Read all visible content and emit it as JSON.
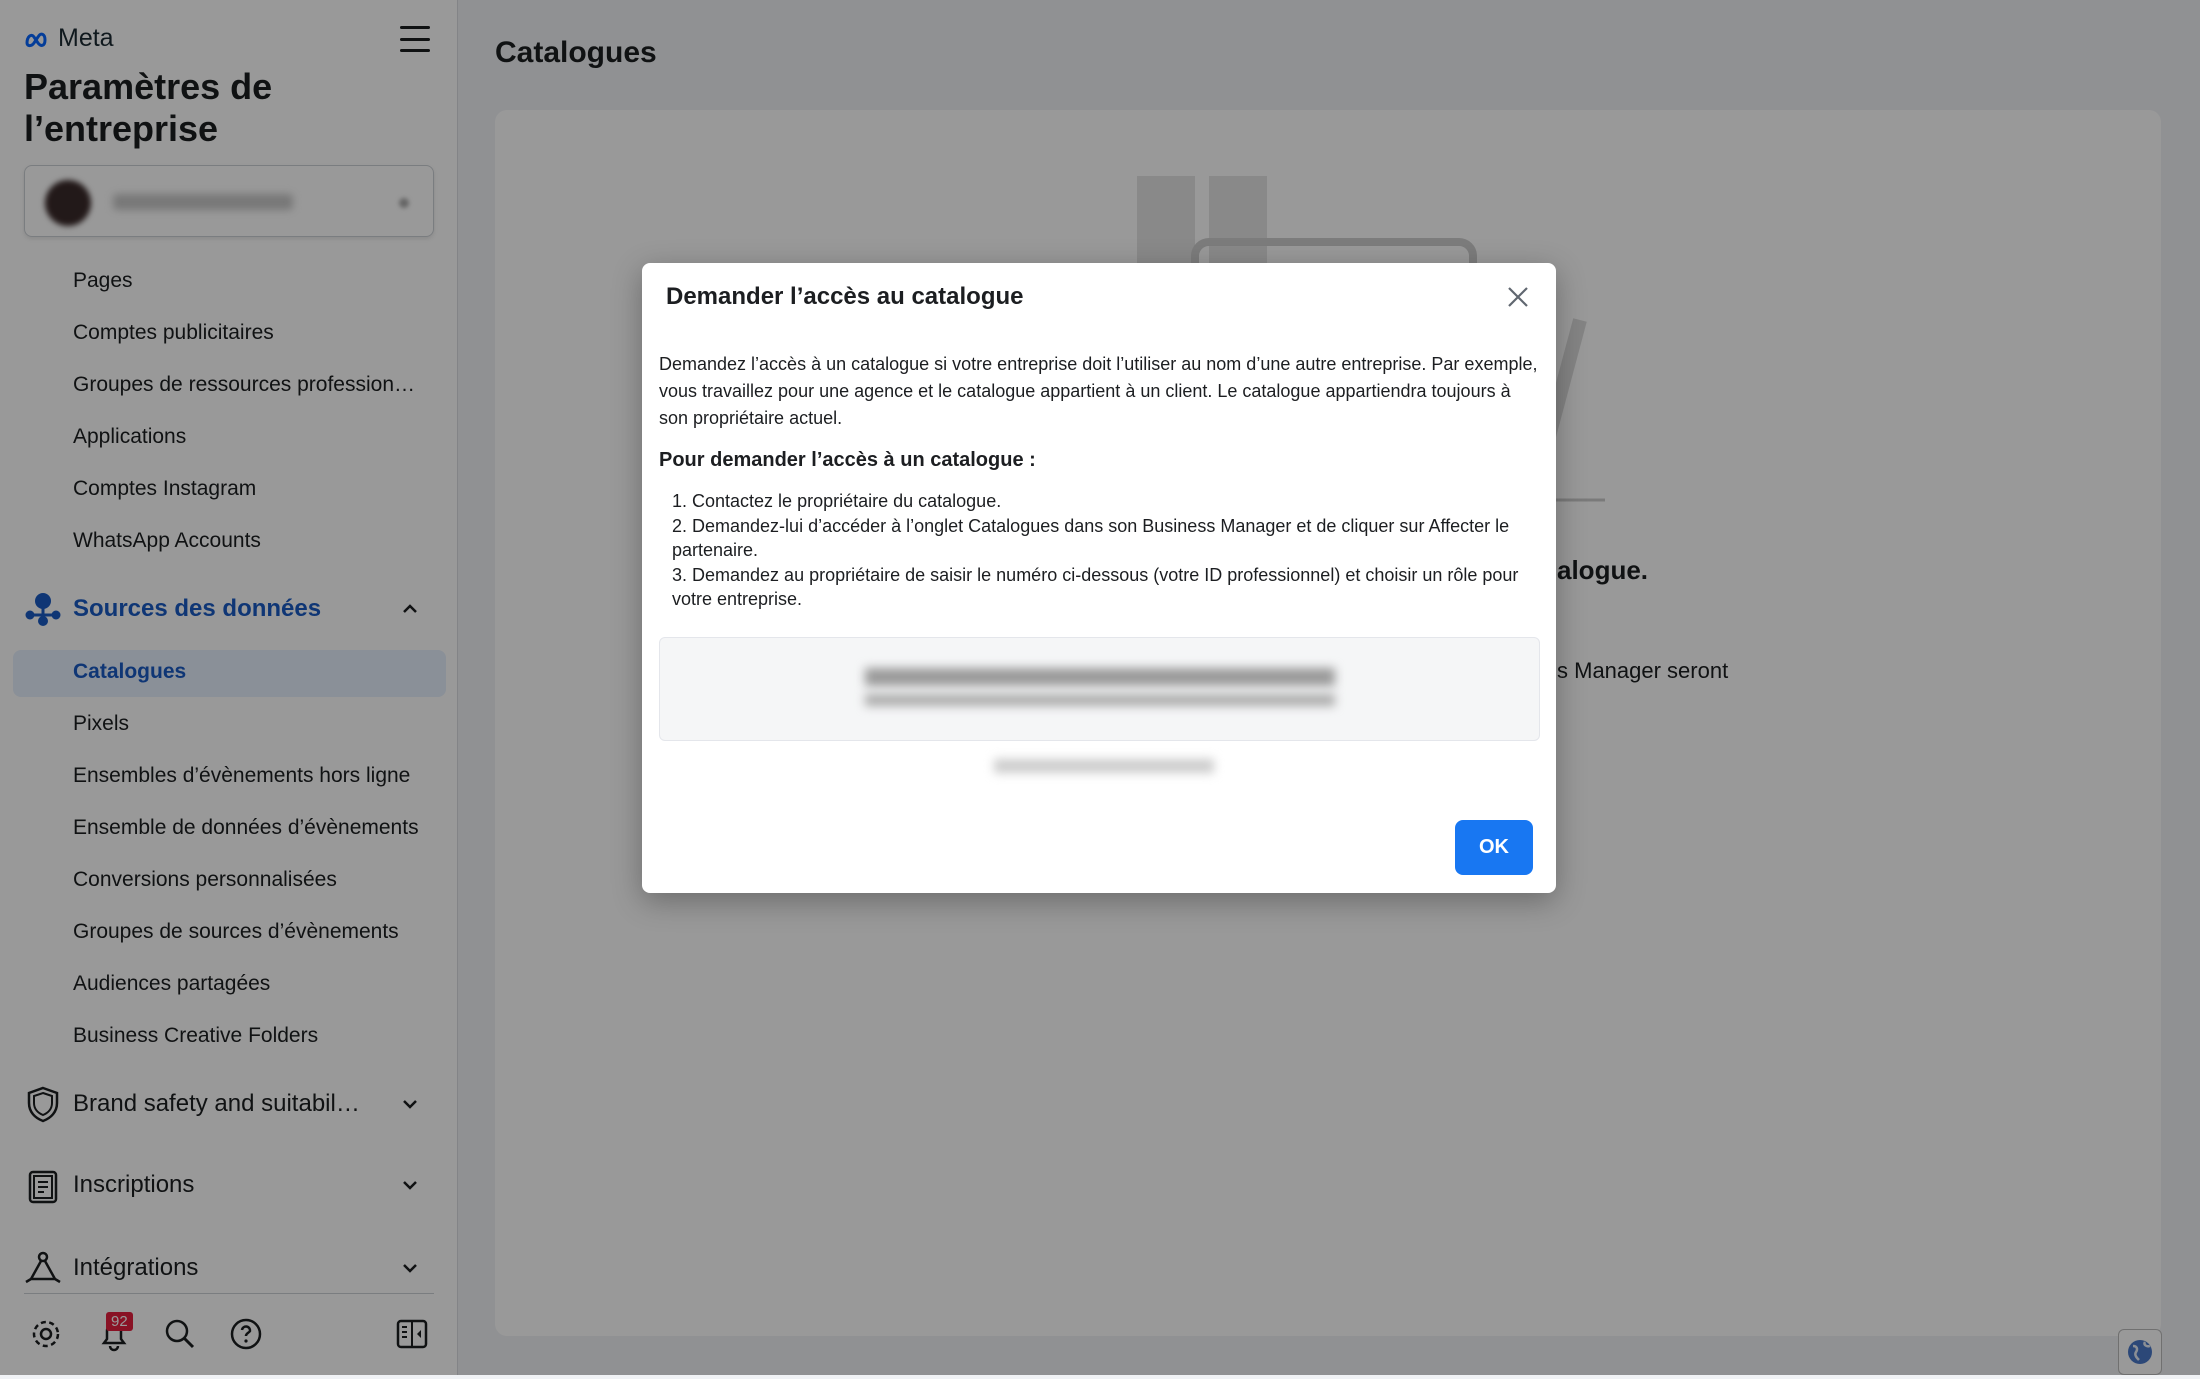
{
  "brand": {
    "logo": "Meta"
  },
  "sidebar": {
    "title": "Paramètres de l’entreprise",
    "items": [
      "Pages",
      "Comptes publicitaires",
      "Groupes de ressources profession…",
      "Applications",
      "Comptes Instagram",
      "WhatsApp Accounts"
    ],
    "data_sources": {
      "label": "Sources des données",
      "expanded": true,
      "items": [
        "Catalogues",
        "Pixels",
        "Ensembles d’évènements hors ligne",
        "Ensemble de données d’évènements",
        "Conversions personnalisées",
        "Groupes de sources d’évènements",
        "Audiences partagées",
        "Business Creative Folders"
      ],
      "selected": "Catalogues"
    },
    "sections": [
      "Brand safety and suitabil…",
      "Inscriptions",
      "Intégrations"
    ],
    "notifications_count": "92"
  },
  "main": {
    "title": "Catalogues",
    "background_fragments": [
      "alogue.",
      "s Manager seront"
    ]
  },
  "modal": {
    "title": "Demander l’accès au catalogue",
    "intro": "Demandez l’accès à un catalogue si votre entreprise doit l’utiliser au nom d’une autre entreprise. Par exemple, vous travaillez pour une agence et le catalogue appartient à un client. Le catalogue appartiendra toujours à son propriétaire actuel.",
    "heading": "Pour demander l’accès à un catalogue :",
    "steps": [
      "1. Contactez le propriétaire du catalogue.",
      "2. Demandez-lui d’accéder à l’onglet Catalogues dans son Business Manager et de cliquer sur Affecter le partenaire.",
      "3. Demandez au propriétaire de saisir le numéro ci-dessous (votre ID professionnel) et choisir un rôle pour votre entreprise."
    ],
    "ok_label": "OK"
  },
  "colors": {
    "accent": "#1877f2",
    "selected_bg": "#e7f0fd",
    "badge": "#e41e3f",
    "overlay": "rgba(0,0,0,0.4)"
  }
}
